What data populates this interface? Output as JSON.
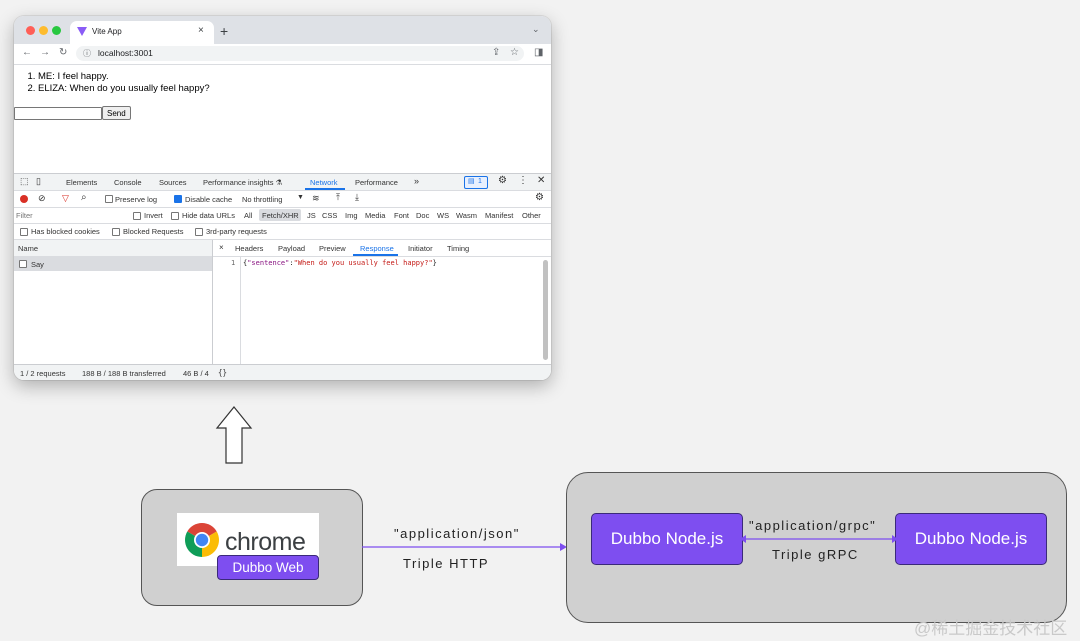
{
  "browser": {
    "tab_title": "Vite App",
    "tab_close": "×",
    "new_tab": "+",
    "tab_menu": "⌄",
    "url": "localhost:3001",
    "icons": [
      "back-icon",
      "forward-icon",
      "reload-icon",
      "info-icon",
      "share-icon",
      "bookmark-star-icon",
      "sidebar-icon"
    ]
  },
  "page": {
    "messages": [
      "ME: I feel happy.",
      "ELIZA: When do you usually feel happy?"
    ],
    "input_value": "",
    "send_label": "Send"
  },
  "devtools": {
    "tabs": [
      "Elements",
      "Console",
      "Sources",
      "Performance insights ⚗",
      "Network",
      "Performance",
      "»"
    ],
    "active_tab": "Network",
    "issues_badge": "1",
    "toolbar": {
      "preserve_log": "Preserve log",
      "disable_cache": "Disable cache",
      "throttling": "No throttling"
    },
    "filter": {
      "placeholder": "Filter",
      "invert": "Invert",
      "hide_data_urls": "Hide data URLs",
      "types": [
        "All",
        "Fetch/XHR",
        "JS",
        "CSS",
        "Img",
        "Media",
        "Font",
        "Doc",
        "WS",
        "Wasm",
        "Manifest",
        "Other"
      ],
      "active_type": "Fetch/XHR",
      "has_blocked_cookies": "Has blocked cookies",
      "blocked_requests": "Blocked Requests",
      "third_party": "3rd-party requests"
    },
    "requests": {
      "column_name": "Name",
      "rows": [
        "Say"
      ]
    },
    "detail": {
      "close": "×",
      "tabs": [
        "Headers",
        "Payload",
        "Preview",
        "Response",
        "Initiator",
        "Timing"
      ],
      "active_tab": "Response",
      "line_number": "1",
      "response_key": "\"sentence\"",
      "response_value": "\"When do you usually feel happy?\""
    },
    "status": {
      "requests": "1 / 2 requests",
      "transferred": "188 B / 188 B transferred",
      "resources": "46 B / 4",
      "pretty_print": "{}"
    }
  },
  "diagram": {
    "chrome_word": "chrome",
    "dubbo_web": "Dubbo Web",
    "http_content_type": "\"application/json\"",
    "http_protocol": "Triple HTTP",
    "node_left": "Dubbo Node.js",
    "node_right": "Dubbo Node.js",
    "grpc_content_type": "\"application/grpc\"",
    "grpc_protocol": "Triple gRPC",
    "colors": {
      "dubbo_purple": "#7e4ef0",
      "box_grey": "#d0d0d0",
      "arrow": "#7e4ef0"
    }
  },
  "watermark": "@稀土掘金技术社区"
}
